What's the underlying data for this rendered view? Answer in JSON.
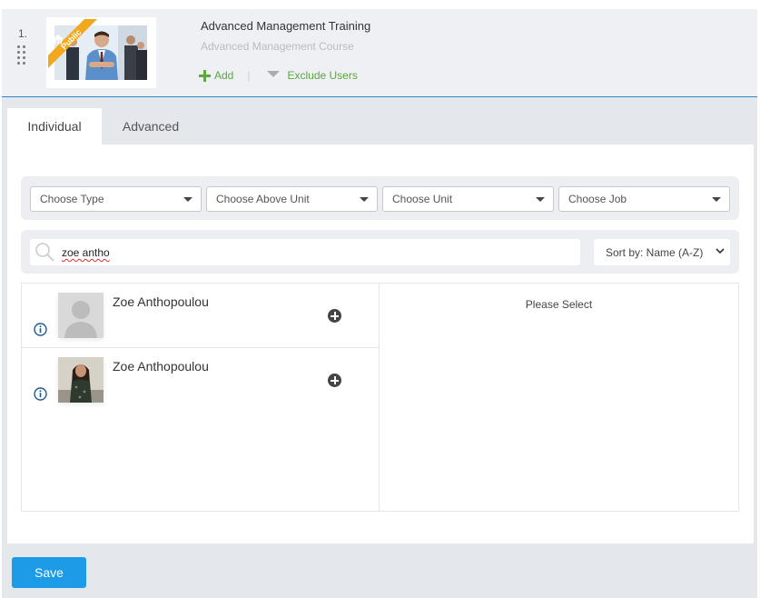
{
  "course": {
    "index": "1.",
    "title": "Advanced Management Training",
    "subtitle": "Advanced Management Course",
    "badge": "Public",
    "add_label": "Add",
    "separator": "|",
    "exclude_label": "Exclude Users"
  },
  "tabs": [
    {
      "label": "Individual",
      "active": true
    },
    {
      "label": "Advanced",
      "active": false
    }
  ],
  "filters": {
    "type": "Choose Type",
    "above_unit": "Choose Above Unit",
    "unit": "Choose Unit",
    "job": "Choose Job"
  },
  "search": {
    "value": "zoe antho",
    "sort": "Sort by: Name (A-Z)"
  },
  "results": [
    {
      "name": "Zoe Anthopoulou",
      "avatar": "placeholder"
    },
    {
      "name": "Zoe Anthopoulou",
      "avatar": "photo"
    }
  ],
  "details": {
    "placeholder": "Please Select"
  },
  "footer": {
    "save_label": "Save"
  },
  "colors": {
    "accent": "#1d9be6",
    "green": "#5aa93c",
    "badge": "#f2a81d"
  }
}
